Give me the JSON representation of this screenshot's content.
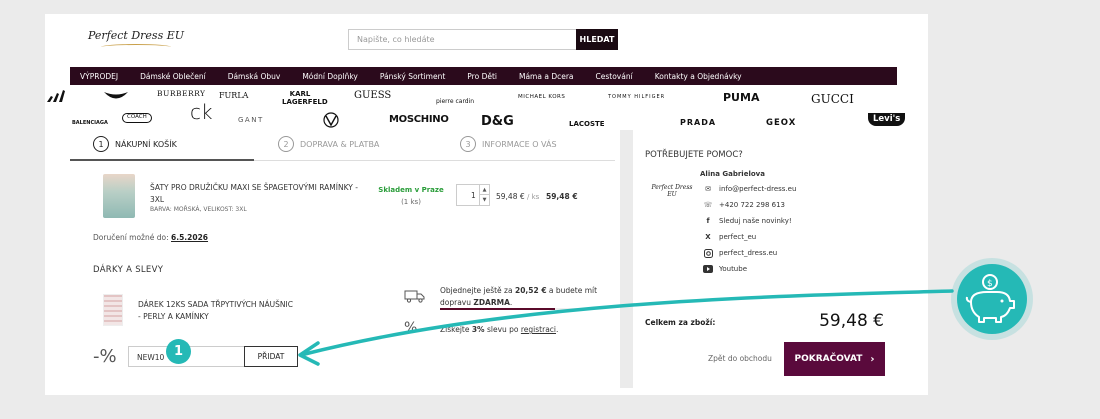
{
  "header": {
    "logo_text": "Perfect Dress EU",
    "search_placeholder": "Napište, co hledáte",
    "search_button": "HLEDAT"
  },
  "nav": [
    "VÝPRODEJ",
    "Dámské Oblečení",
    "Dámská Obuv",
    "Módní Doplňky",
    "Pánský Sortiment",
    "Pro Děti",
    "Máma a Dcera",
    "Cestování",
    "Kontakty a Objednávky"
  ],
  "brands_row1": [
    "BURBERRY",
    "FURLA",
    "KARL LAGERFELD",
    "GUESS",
    "pierre cardin",
    "MICHAEL KORS",
    "TOMMY HILFIGER",
    "PUMA",
    "GUCCI"
  ],
  "brands_row2": [
    "BALENCIAGA",
    "COACH",
    "ck",
    "GANT",
    "MOSCHINO",
    "D&G",
    "LACOSTE",
    "PRADA",
    "GEOX",
    "Levi's"
  ],
  "steps": [
    {
      "num": "1",
      "label": "NÁKUPNÍ KOŠÍK"
    },
    {
      "num": "2",
      "label": "DOPRAVA & PLATBA"
    },
    {
      "num": "3",
      "label": "INFORMACE O VÁS"
    }
  ],
  "cart_item": {
    "name": "ŠATY PRO DRUŽIČKU MAXI SE ŠPAGETOVÝMI RAMÍNKY - 3XL",
    "attributes": "BARVA: MOŘSKÁ, VELIKOST: 3XL",
    "stock": "Skladem v Praze",
    "stock_qty": "(1 ks)",
    "quantity": "1",
    "unit_price": "59,48 €",
    "unit_suffix": "/ ks",
    "line_total": "59,48 €"
  },
  "delivery": {
    "label": "Doručení možné do:",
    "date": "6.5.2026"
  },
  "gifts": {
    "title": "DÁRKY A SLEVY",
    "gift_name": "DÁREK 12KS SADA TŘPYTIVÝCH NÁUŠNIC - PERLY A KAMÍNKY"
  },
  "free_shipping": {
    "pre": "Objednejte ještě za ",
    "amount": "20,52 €",
    "mid": " a budete mít dopravu ",
    "free": "ZDARMA",
    "end": ".",
    "progress": 0.74
  },
  "registration_discount": {
    "pre": "Získejte ",
    "pct": "3%",
    "mid": " slevu po ",
    "link": "registraci",
    "end": "."
  },
  "coupon": {
    "percent_icon": "-%",
    "value": "NEW10",
    "button": "PŘIDAT"
  },
  "help": {
    "title": "POTŘEBUJETE POMOC?",
    "logo_text": "Perfect Dress EU",
    "name": "Alina Gabrielova",
    "email": "info@perfect-dress.eu",
    "phone": "+420 722 298 613",
    "facebook": "Sleduj naše novinky!",
    "x": "perfect_eu",
    "instagram": "perfect_dress.eu",
    "youtube": "Youtube"
  },
  "summary": {
    "label": "Celkem za zboží:",
    "value": "59,48 €",
    "back": "Zpět do obchodu",
    "continue": "POKRAČOVAT"
  },
  "overlay": {
    "step_badge": "1",
    "accent": "#25b9b6"
  },
  "colors": {
    "nav_bg": "#2b0a1c",
    "cta_bg": "#5a0a3c",
    "stock_green": "#2a9d3a"
  }
}
